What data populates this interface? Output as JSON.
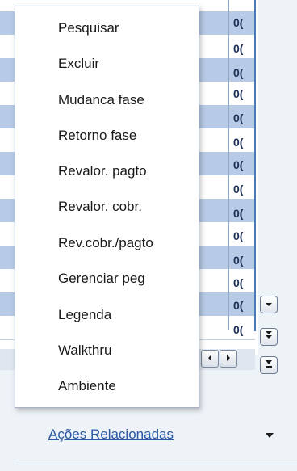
{
  "menu": {
    "items": [
      {
        "label": "Pesquisar"
      },
      {
        "label": "Excluir"
      },
      {
        "label": "Mudanca fase"
      },
      {
        "label": "Retorno fase"
      },
      {
        "label": "Revalor. pagto"
      },
      {
        "label": "Revalor. cobr."
      },
      {
        "label": "Rev.cobr./pagto"
      },
      {
        "label": "Gerenciar peg"
      },
      {
        "label": "Legenda"
      },
      {
        "label": "Walkthru"
      },
      {
        "label": "Ambiente"
      }
    ]
  },
  "table": {
    "cells": [
      "0(",
      "0(",
      "0(",
      "0(",
      "0(",
      "0(",
      "0(",
      "0(",
      "0(",
      "0(",
      "0(",
      "0(",
      "0(",
      "0("
    ]
  },
  "footer": {
    "related_actions": "Ações Relacionadas"
  },
  "icons": {
    "scroll_down": "chevron-down-icon",
    "scroll_down_double": "double-chevron-down-icon",
    "scroll_bottom": "scroll-to-bottom-icon",
    "scroll_left": "chevron-left-icon",
    "scroll_right": "chevron-right-icon",
    "dropdown": "caret-down-icon"
  },
  "colors": {
    "row_highlight": "#b7cbe6",
    "grid_border": "#4d79b8",
    "link": "#2a5aa4",
    "panel_bg": "#eef3f8"
  }
}
